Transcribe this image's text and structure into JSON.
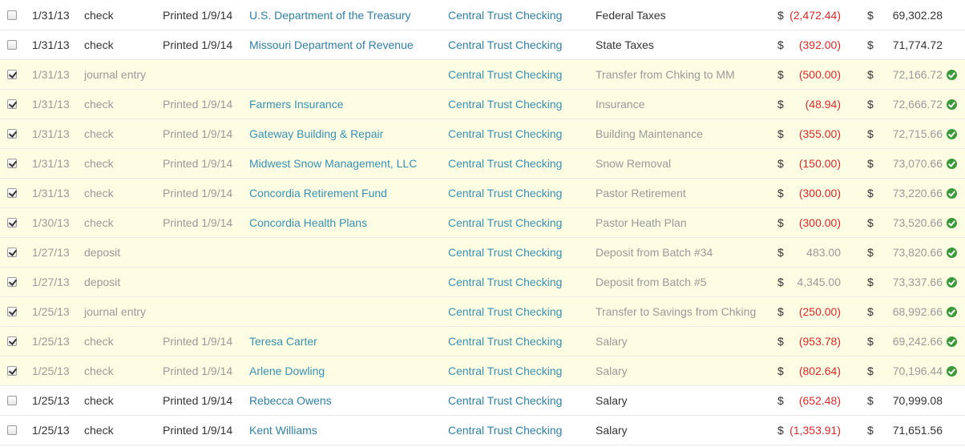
{
  "transactions": [
    {
      "checked": false,
      "date": "1/31/13",
      "type": "check",
      "number": "Printed 1/9/14",
      "payee": "U.S. Department of the Treasury",
      "account": "Central Trust Checking",
      "memo": "Federal Taxes",
      "currency": "$",
      "amount": "(2,472.44)",
      "amount_negative": true,
      "balance_currency": "$",
      "balance": "69,302.28",
      "cleared": false
    },
    {
      "checked": false,
      "date": "1/31/13",
      "type": "check",
      "number": "Printed 1/9/14",
      "payee": "Missouri Department of Revenue",
      "account": "Central Trust Checking",
      "memo": "State Taxes",
      "currency": "$",
      "amount": "(392.00)",
      "amount_negative": true,
      "balance_currency": "$",
      "balance": "71,774.72",
      "cleared": false
    },
    {
      "checked": true,
      "date": "1/31/13",
      "type": "journal entry",
      "number": "",
      "payee": "",
      "account": "Central Trust Checking",
      "memo": "Transfer from Chking to MM",
      "currency": "$",
      "amount": "(500.00)",
      "amount_negative": true,
      "balance_currency": "$",
      "balance": "72,166.72",
      "cleared": true
    },
    {
      "checked": true,
      "date": "1/31/13",
      "type": "check",
      "number": "Printed 1/9/14",
      "payee": "Farmers Insurance",
      "account": "Central Trust Checking",
      "memo": "Insurance",
      "currency": "$",
      "amount": "(48.94)",
      "amount_negative": true,
      "balance_currency": "$",
      "balance": "72,666.72",
      "cleared": true
    },
    {
      "checked": true,
      "date": "1/31/13",
      "type": "check",
      "number": "Printed 1/9/14",
      "payee": "Gateway Building & Repair",
      "account": "Central Trust Checking",
      "memo": "Building Maintenance",
      "currency": "$",
      "amount": "(355.00)",
      "amount_negative": true,
      "balance_currency": "$",
      "balance": "72,715.66",
      "cleared": true
    },
    {
      "checked": true,
      "date": "1/31/13",
      "type": "check",
      "number": "Printed 1/9/14",
      "payee": "Midwest Snow Management, LLC",
      "account": "Central Trust Checking",
      "memo": "Snow Removal",
      "currency": "$",
      "amount": "(150.00)",
      "amount_negative": true,
      "balance_currency": "$",
      "balance": "73,070.66",
      "cleared": true
    },
    {
      "checked": true,
      "date": "1/31/13",
      "type": "check",
      "number": "Printed 1/9/14",
      "payee": "Concordia Retirement Fund",
      "account": "Central Trust Checking",
      "memo": "Pastor Retirement",
      "currency": "$",
      "amount": "(300.00)",
      "amount_negative": true,
      "balance_currency": "$",
      "balance": "73,220.66",
      "cleared": true
    },
    {
      "checked": true,
      "date": "1/30/13",
      "type": "check",
      "number": "Printed 1/9/14",
      "payee": "Concordia Health Plans",
      "account": "Central Trust Checking",
      "memo": "Pastor Heath Plan",
      "currency": "$",
      "amount": "(300.00)",
      "amount_negative": true,
      "balance_currency": "$",
      "balance": "73,520.66",
      "cleared": true
    },
    {
      "checked": true,
      "date": "1/27/13",
      "type": "deposit",
      "number": "",
      "payee": "",
      "account": "Central Trust Checking",
      "memo": "Deposit from Batch #34",
      "currency": "$",
      "amount": "483.00",
      "amount_negative": false,
      "balance_currency": "$",
      "balance": "73,820.66",
      "cleared": true
    },
    {
      "checked": true,
      "date": "1/27/13",
      "type": "deposit",
      "number": "",
      "payee": "",
      "account": "Central Trust Checking",
      "memo": "Deposit from Batch #5",
      "currency": "$",
      "amount": "4,345.00",
      "amount_negative": false,
      "balance_currency": "$",
      "balance": "73,337.66",
      "cleared": true
    },
    {
      "checked": true,
      "date": "1/25/13",
      "type": "journal entry",
      "number": "",
      "payee": "",
      "account": "Central Trust Checking",
      "memo": "Transfer to Savings from Chking",
      "currency": "$",
      "amount": "(250.00)",
      "amount_negative": true,
      "balance_currency": "$",
      "balance": "68,992.66",
      "cleared": true
    },
    {
      "checked": true,
      "date": "1/25/13",
      "type": "check",
      "number": "Printed 1/9/14",
      "payee": "Teresa Carter",
      "account": "Central Trust Checking",
      "memo": "Salary",
      "currency": "$",
      "amount": "(953.78)",
      "amount_negative": true,
      "balance_currency": "$",
      "balance": "69,242.66",
      "cleared": true
    },
    {
      "checked": true,
      "date": "1/25/13",
      "type": "check",
      "number": "Printed 1/9/14",
      "payee": "Arlene Dowling",
      "account": "Central Trust Checking",
      "memo": "Salary",
      "currency": "$",
      "amount": "(802.64)",
      "amount_negative": true,
      "balance_currency": "$",
      "balance": "70,196.44",
      "cleared": true
    },
    {
      "checked": false,
      "date": "1/25/13",
      "type": "check",
      "number": "Printed 1/9/14",
      "payee": "Rebecca Owens",
      "account": "Central Trust Checking",
      "memo": "Salary",
      "currency": "$",
      "amount": "(652.48)",
      "amount_negative": true,
      "balance_currency": "$",
      "balance": "70,999.08",
      "cleared": false
    },
    {
      "checked": false,
      "date": "1/25/13",
      "type": "check",
      "number": "Printed 1/9/14",
      "payee": "Kent Williams",
      "account": "Central Trust Checking",
      "memo": "Salary",
      "currency": "$",
      "amount": "(1,353.91)",
      "amount_negative": true,
      "balance_currency": "$",
      "balance": "71,651.56",
      "cleared": false
    }
  ],
  "icons": {
    "cleared": "check-circle-icon"
  },
  "colors": {
    "link": "#2f7fa3",
    "negative": "#d42a2a",
    "reconciled_bg": "#fdfde4",
    "cleared_icon": "#3a9a3a"
  }
}
